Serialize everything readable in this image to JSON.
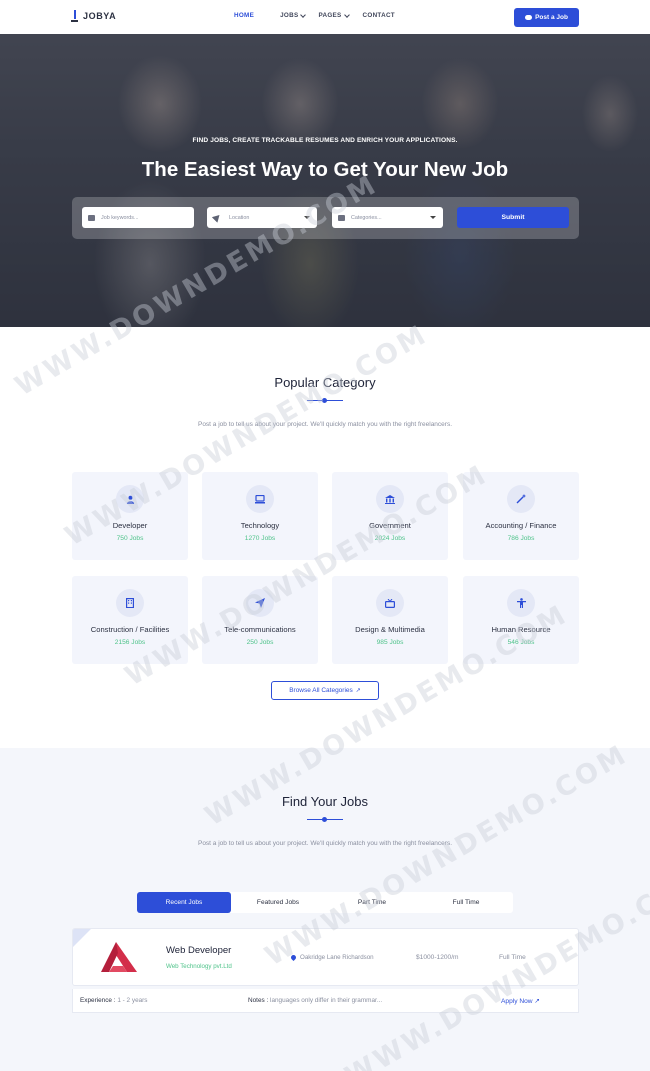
{
  "nav": {
    "logo": "JOBYA",
    "menu": [
      {
        "label": "HOME",
        "active": true,
        "dropdown": false
      },
      {
        "label": "JOBS",
        "active": false,
        "dropdown": true
      },
      {
        "label": "PAGES",
        "active": false,
        "dropdown": true
      },
      {
        "label": "CONTACT",
        "active": false,
        "dropdown": false
      }
    ],
    "post_button": "Post a Job"
  },
  "hero": {
    "subtitle": "FIND JOBS, CREATE TRACKABLE RESUMES AND ENRICH YOUR APPLICATIONS.",
    "title": "The Easiest Way to Get Your New Job",
    "search": {
      "keywords_placeholder": "Job keywords...",
      "location_value": "Location",
      "category_value": "Categories...",
      "submit": "Submit"
    }
  },
  "popular": {
    "title": "Popular Category",
    "description": "Post a job to tell us about your project. We'll quickly match you with the right freelancers.",
    "categories": [
      {
        "name": "Developer",
        "count": "750 Jobs",
        "icon": "user-icon"
      },
      {
        "name": "Technology",
        "count": "1270 Jobs",
        "icon": "monitor-icon"
      },
      {
        "name": "Government",
        "count": "2024 Jobs",
        "icon": "bank-icon"
      },
      {
        "name": "Accounting / Finance",
        "count": "786 Jobs",
        "icon": "magic-wand-icon"
      },
      {
        "name": "Construction / Facilities",
        "count": "2156 Jobs",
        "icon": "building-icon"
      },
      {
        "name": "Tele-communications",
        "count": "250 Jobs",
        "icon": "send-icon"
      },
      {
        "name": "Design & Multimedia",
        "count": "985 Jobs",
        "icon": "tv-icon"
      },
      {
        "name": "Human Resource",
        "count": "546 Jobs",
        "icon": "person-icon"
      }
    ],
    "browse_button": "Browse All Categories"
  },
  "jobs": {
    "title": "Find Your Jobs",
    "description": "Post a job to tell us about your project. We'll quickly match you with the right freelancers.",
    "tabs": [
      "Recent Jobs",
      "Featured Jobs",
      "Part Time",
      "Full Time"
    ],
    "active_tab": 0,
    "listing": {
      "title": "Web Developer",
      "company": "Web Technology pvt.Ltd",
      "location": "Oakridge Lane Richardson",
      "salary": "$1000-1200/m",
      "type": "Full Time",
      "experience_label": "Experience :",
      "experience_value": "1 - 2 years",
      "notes_label": "Notes :",
      "notes_value": "languages only differ in their grammar...",
      "apply": "Apply Now"
    }
  },
  "watermark": "WWW.DOWNDEMO.COM",
  "colors": {
    "primary": "#2d4ed8",
    "success": "#4fc38a",
    "card_bg": "#f3f5fc"
  }
}
